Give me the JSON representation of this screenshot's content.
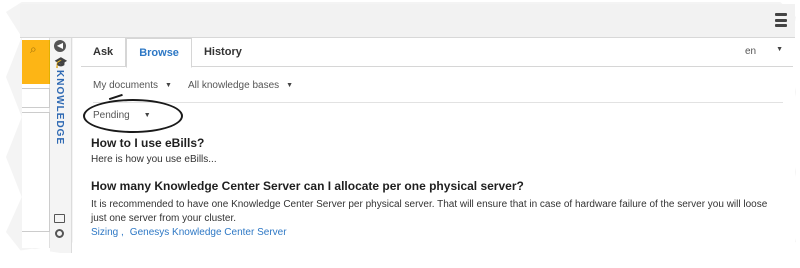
{
  "header": {
    "menu_icon": "hamburger-menu-icon"
  },
  "left_panel": {
    "collapse_icon": "chevron-left-icon",
    "item_icon": "search-icon"
  },
  "knowledge_sidebar": {
    "label": "KNOWLEDGE",
    "collapse_icon": "circle-arrow-left-icon",
    "label_icon": "graduation-cap-icon",
    "bottom_icons": [
      "monitor-icon",
      "circle-icon"
    ]
  },
  "tabs": [
    {
      "label": "Ask",
      "active": false
    },
    {
      "label": "Browse",
      "active": true
    },
    {
      "label": "History",
      "active": false
    }
  ],
  "language": {
    "value": "en",
    "caret": "▼"
  },
  "filters": {
    "documents": {
      "value": "My documents",
      "caret": "▼"
    },
    "knowledge_bases": {
      "value": "All knowledge bases",
      "caret": "▼"
    },
    "status": {
      "value": "Pending",
      "caret": "▼"
    }
  },
  "articles": [
    {
      "title": "How to I use eBills?",
      "summary": "Here is how you use eBills..."
    },
    {
      "title": "How many Knowledge Center Server can I allocate per one physical server?",
      "summary": "It is recommended to have one Knowledge Center Server per physical server. That will ensure that in case of hardware failure of the server you will loose just one server from your cluster."
    }
  ],
  "tags": {
    "first": "Sizing ,",
    "second": "Genesys Knowledge Center Server"
  },
  "colors": {
    "accent": "#2e78c5",
    "sidebar_label": "#2e69b3",
    "left_highlight": "#fdb515"
  }
}
